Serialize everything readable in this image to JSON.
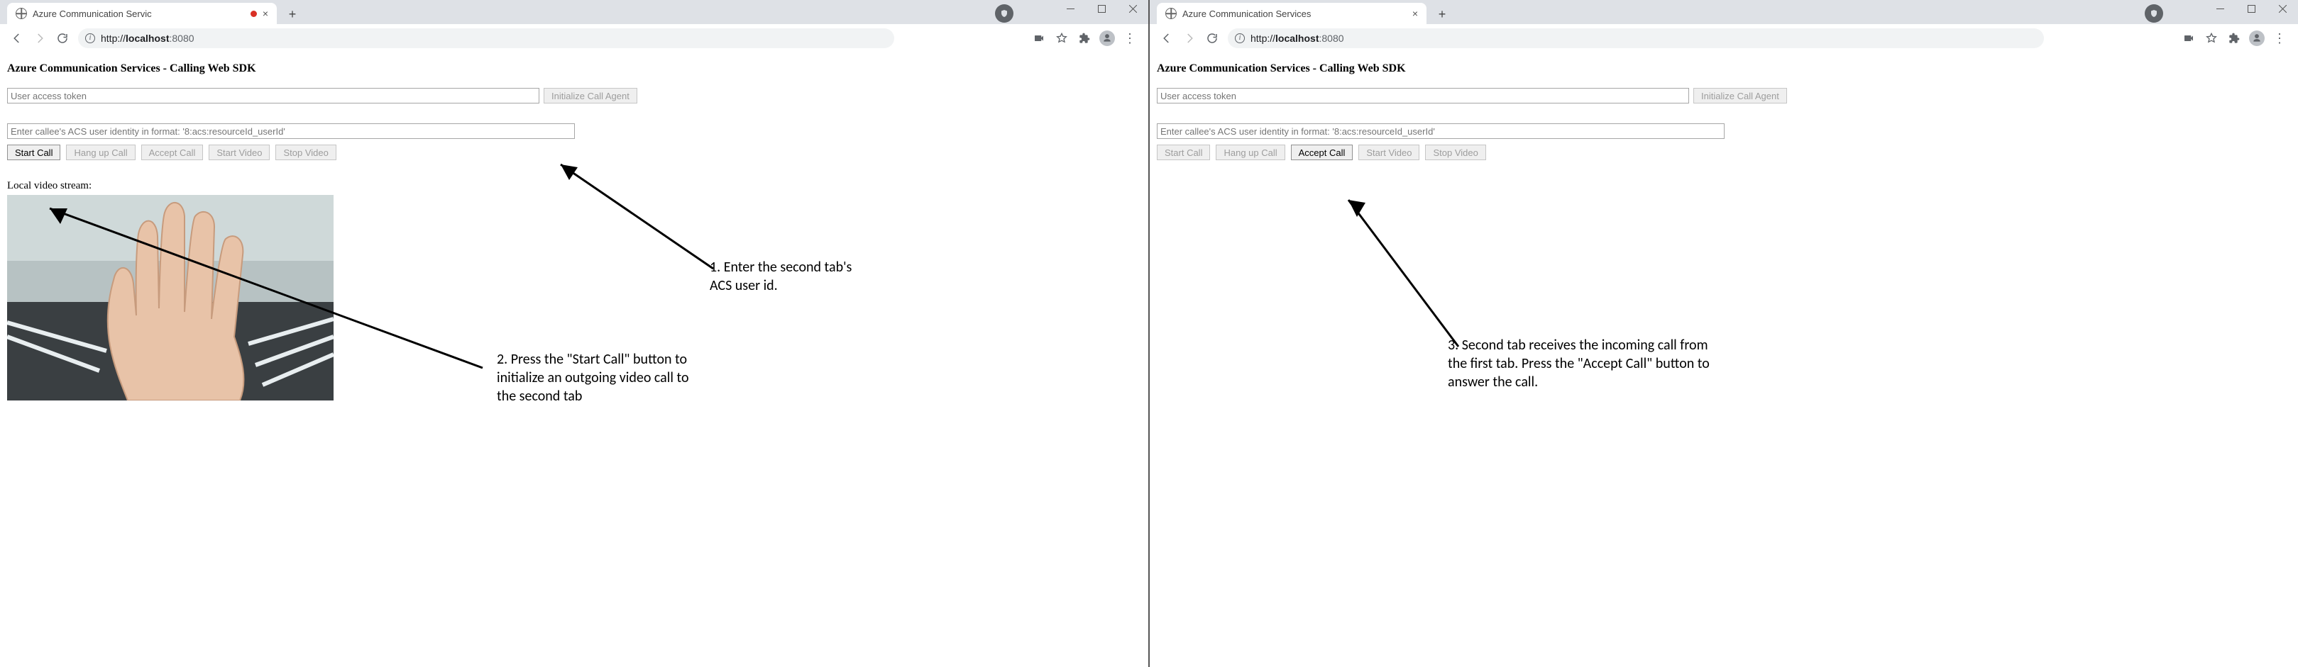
{
  "left": {
    "tab_title": "Azure Communication Servic",
    "has_recording_dot": true,
    "url_host": "localhost",
    "url_port": ":8080",
    "url_protocol": "http://",
    "page_heading": "Azure Communication Services - Calling Web SDK",
    "token_placeholder": "User access token",
    "init_agent_label": "Initialize Call Agent",
    "callee_placeholder": "Enter callee's ACS user identity in format: '8:acs:resourceId_userId'",
    "buttons": {
      "start": "Start Call",
      "hangup": "Hang up Call",
      "accept": "Accept Call",
      "startv": "Start Video",
      "stopv": "Stop Video"
    },
    "enabled": {
      "start": true,
      "hangup": false,
      "accept": false,
      "startv": false,
      "stopv": false,
      "init_agent": false
    },
    "stream_label": "Local video stream:",
    "annotations": {
      "a1": "1. Enter the second tab's\nACS user id.",
      "a2": "2. Press the \"Start Call\" button to\ninitialize an outgoing video call to\nthe second tab"
    }
  },
  "right": {
    "tab_title": "Azure Communication Services",
    "has_recording_dot": false,
    "url_host": "localhost",
    "url_port": ":8080",
    "url_protocol": "http://",
    "page_heading": "Azure Communication Services - Calling Web SDK",
    "token_placeholder": "User access token",
    "init_agent_label": "Initialize Call Agent",
    "callee_placeholder": "Enter callee's ACS user identity in format: '8:acs:resourceId_userId'",
    "buttons": {
      "start": "Start Call",
      "hangup": "Hang up Call",
      "accept": "Accept Call",
      "startv": "Start Video",
      "stopv": "Stop Video"
    },
    "enabled": {
      "start": false,
      "hangup": false,
      "accept": true,
      "startv": false,
      "stopv": false,
      "init_agent": false
    },
    "annotations": {
      "a3": "3. Second tab receives the incoming call from\nthe first tab. Press the \"Accept Call\" button to\nanswer the call."
    }
  }
}
